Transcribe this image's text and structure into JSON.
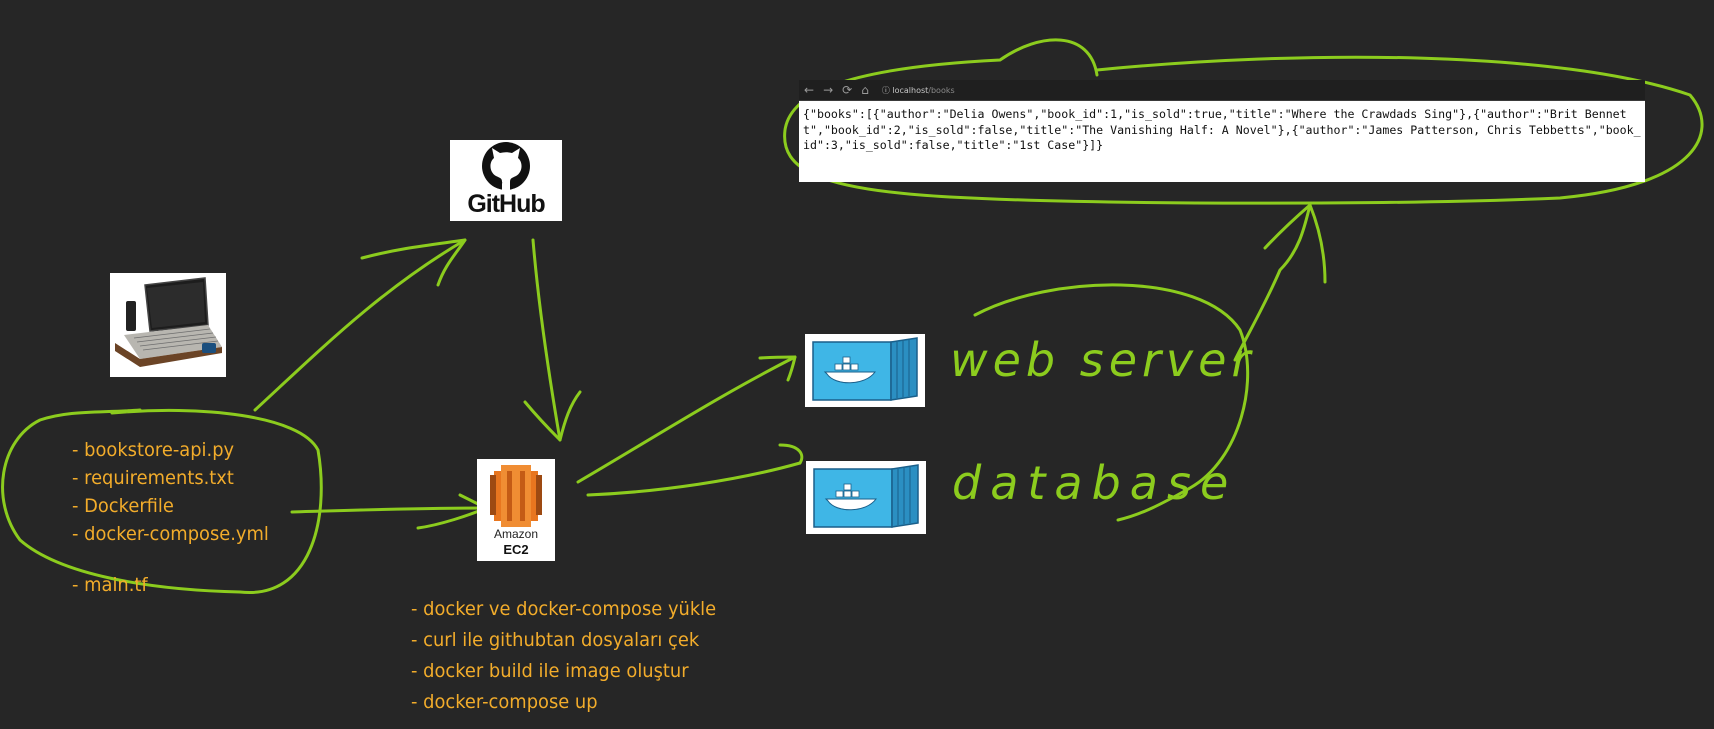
{
  "browser": {
    "nav_glyphs": [
      "←",
      "→",
      "⟳",
      "⌂"
    ],
    "info_glyph": "ⓘ",
    "url_host": "localhost",
    "url_path": "/books",
    "response": "{\"books\":[{\"author\":\"Delia Owens\",\"book_id\":1,\"is_sold\":true,\"title\":\"Where the Crawdads Sing\"},{\"author\":\"Brit Bennett\",\"book_id\":2,\"is_sold\":false,\"title\":\"The Vanishing Half: A Novel\"},{\"author\":\"James Patterson, Chris Tebbetts\",\"book_id\":3,\"is_sold\":false,\"title\":\"1st Case\"}]}"
  },
  "github": {
    "wordmark": "GitHub",
    "icon": "github-octocat-icon"
  },
  "laptop": {
    "icon": "laptop-image"
  },
  "ec2": {
    "brand": "Amazon",
    "model": "EC2",
    "icon": "aws-ec2-icon"
  },
  "containers": [
    {
      "icon": "docker-container-icon",
      "label": "web server"
    },
    {
      "icon": "docker-container-icon",
      "label": "database"
    }
  ],
  "files": [
    "- bookstore-api.py",
    "- requirements.txt",
    "- Dockerfile",
    "- docker-compose.yml"
  ],
  "terraform_file": "- main.tf",
  "steps": [
    "- docker ve docker-compose yükle",
    "- curl ile githubtan dosyaları çek",
    "- docker build ile image oluştur",
    "- docker-compose up"
  ],
  "colors": {
    "background": "#262626",
    "ink_green": "#8ccc1e",
    "ink_orange": "#f2ac2b",
    "aws_orange": "#e8761f",
    "docker_blue": "#3fb6e6"
  }
}
